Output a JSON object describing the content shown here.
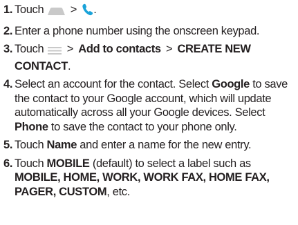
{
  "steps": [
    {
      "number": "1.",
      "parts": {
        "touch": "Touch",
        "gt": ">",
        "end": "."
      },
      "icons": [
        "home-screen-icon",
        "phone-icon"
      ]
    },
    {
      "number": "2.",
      "text": "Enter a phone number using the onscreen keypad."
    },
    {
      "number": "3.",
      "parts": {
        "touch": "Touch",
        "gt1": ">",
        "add": "Add to contacts",
        "gt2": ">",
        "create": "CREATE NEW CONTACT",
        "end": "."
      },
      "icons": [
        "menu-icon"
      ]
    },
    {
      "number": "4.",
      "parts": {
        "a": "Select an account for the contact. Select",
        "google": "Google",
        "b": "to save the contact to your Google account, which will update automatically across all your Google devices. Select",
        "phone": "Phone",
        "c": "to save the contact to your phone only."
      }
    },
    {
      "number": "5.",
      "parts": {
        "touch": "Touch",
        "name": "Name",
        "rest": "and enter a name for the new entry."
      }
    },
    {
      "number": "6.",
      "parts": {
        "touch": "Touch",
        "mobile": "MOBILE",
        "a": "(default) to select a label such as",
        "labels": "MOBILE, HOME, WORK, WORK FAX, HOME FAX, PAGER, CUSTOM",
        "end": ", etc."
      }
    }
  ],
  "colors": {
    "text": "#231f20",
    "phone_icon": "#1aa3d9",
    "ui_icon": "#c9c9c9"
  }
}
